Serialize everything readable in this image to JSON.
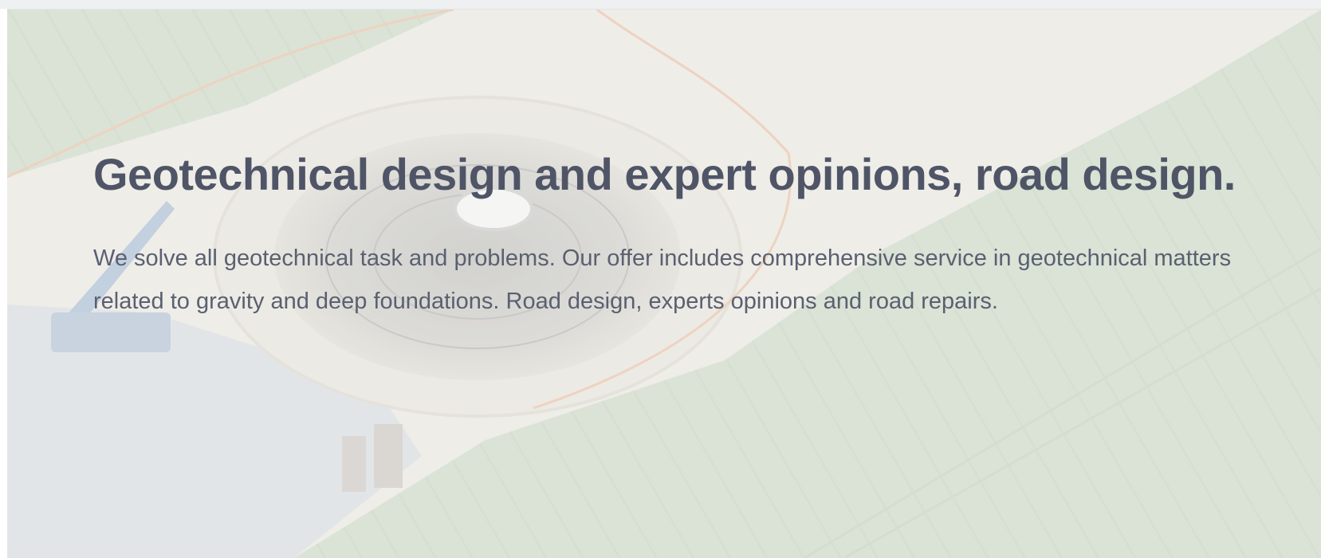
{
  "hero": {
    "title": "Geotechnical design and expert opinions, road design.",
    "description": "We solve all geotechnical task and problems. Our offer includes comprehensive service in geotechnical matters related to gravity and deep foundations. Road design, experts opinions and road repairs."
  },
  "colors": {
    "title": "#4f5566",
    "text": "#5a6070",
    "field_green": "#c9d6c2",
    "soil": "#ece7df"
  }
}
